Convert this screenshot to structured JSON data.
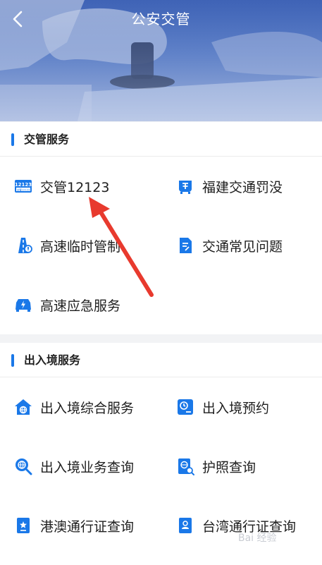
{
  "header": {
    "title": "公安交管"
  },
  "sections": [
    {
      "title": "交管服务",
      "items": [
        {
          "label": "交管12123",
          "icon": "app-12123-icon"
        },
        {
          "label": "福建交通罚没",
          "icon": "fine-icon"
        },
        {
          "label": "高速临时管制",
          "icon": "highway-control-icon"
        },
        {
          "label": "交通常见问题",
          "icon": "faq-doc-icon"
        },
        {
          "label": "高速应急服务",
          "icon": "emergency-car-icon"
        }
      ]
    },
    {
      "title": "出入境服务",
      "items": [
        {
          "label": "出入境综合服务",
          "icon": "home-globe-icon"
        },
        {
          "label": "出入境预约",
          "icon": "appointment-clock-icon"
        },
        {
          "label": "出入境业务查询",
          "icon": "globe-search-icon"
        },
        {
          "label": "护照查询",
          "icon": "passport-search-icon"
        },
        {
          "label": "港澳通行证查询",
          "icon": "hk-macau-permit-icon"
        },
        {
          "label": "台湾通行证查询",
          "icon": "taiwan-permit-icon"
        }
      ]
    }
  ],
  "app_badge": {
    "top": "12123",
    "bottom": "交管12123"
  },
  "watermark": "Bai 经验",
  "colors": {
    "accent": "#1a78e8",
    "annotation_arrow": "#e83a2e"
  }
}
